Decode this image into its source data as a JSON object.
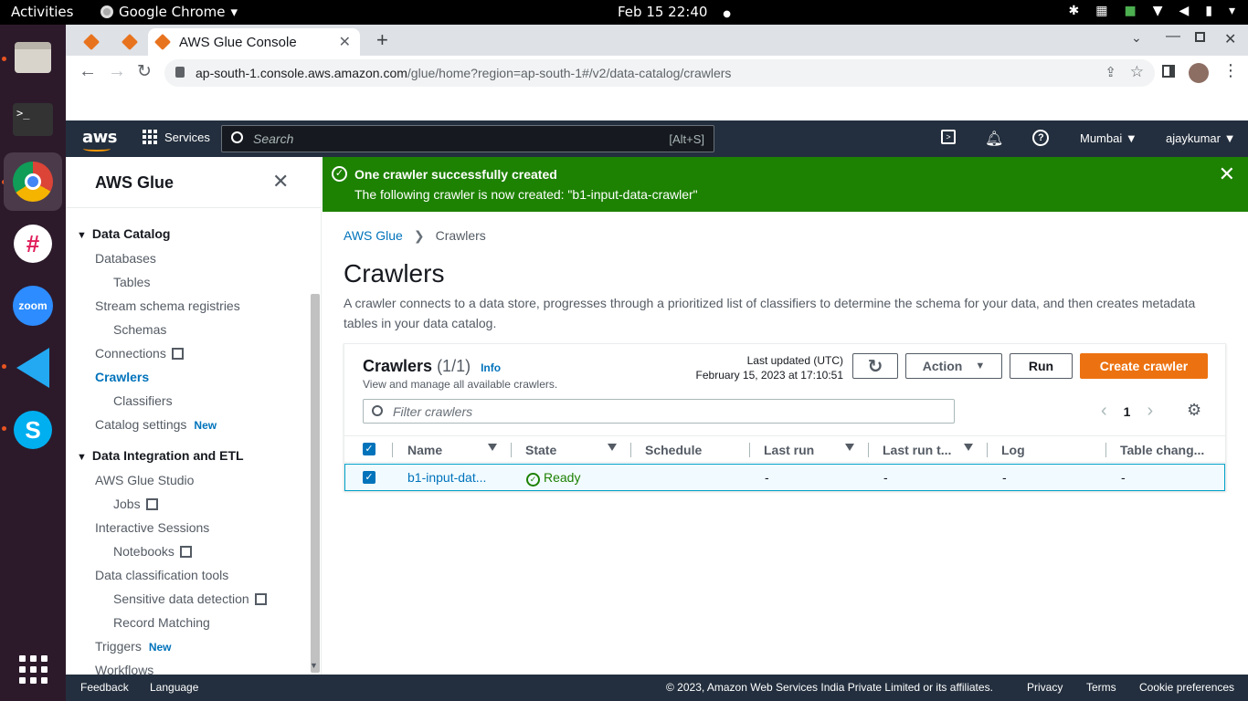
{
  "os": {
    "activities": "Activities",
    "app_name": "Google Chrome",
    "clock": "Feb 15  22:40",
    "dock": [
      "Files",
      "Terminal",
      "Google Chrome",
      "Slack",
      "Zoom",
      "Visual Studio Code",
      "Skype",
      "Show Applications"
    ]
  },
  "browser": {
    "tabs": [
      {
        "label": ""
      },
      {
        "label": ""
      },
      {
        "label": "AWS Glue Console"
      }
    ],
    "url_host": "ap-south-1.console.aws.amazon.com",
    "url_path": "/glue/home?region=ap-south-1#/v2/data-catalog/crawlers"
  },
  "aws_header": {
    "logo": "aws",
    "services_label": "Services",
    "search_placeholder": "Search",
    "search_shortcut": "[Alt+S]",
    "region": "Mumbai",
    "user": "ajaykumar"
  },
  "sidebar": {
    "title": "AWS Glue",
    "data_catalog": "Data Catalog",
    "databases": "Databases",
    "tables": "Tables",
    "stream_schema": "Stream schema registries",
    "schemas": "Schemas",
    "connections": "Connections",
    "crawlers": "Crawlers",
    "classifiers": "Classifiers",
    "catalog_settings": "Catalog settings",
    "new_badge": "New",
    "data_integration": "Data Integration and ETL",
    "glue_studio": "AWS Glue Studio",
    "jobs": "Jobs",
    "interactive": "Interactive Sessions",
    "notebooks": "Notebooks",
    "classification": "Data classification tools",
    "sensitive": "Sensitive data detection",
    "record_matching": "Record Matching",
    "triggers": "Triggers",
    "workflows": "Workflows"
  },
  "flash": {
    "title": "One crawler successfully created",
    "body": "The following crawler is now created: \"b1-input-data-crawler\""
  },
  "main": {
    "breadcrumb_root": "AWS Glue",
    "breadcrumb_current": "Crawlers",
    "title": "Crawlers",
    "description": "A crawler connects to a data store, progresses through a prioritized list of classifiers to determine the schema for your data, and then creates metadata tables in your data catalog."
  },
  "panel": {
    "title": "Crawlers",
    "count": "(1/1)",
    "info": "Info",
    "subtitle": "View and manage all available crawlers.",
    "updated_label": "Last updated (UTC)",
    "updated_value": "February 15, 2023 at 17:10:51",
    "action_label": "Action",
    "run_label": "Run",
    "create_label": "Create crawler",
    "filter_placeholder": "Filter crawlers",
    "page": "1",
    "columns": [
      "Name",
      "State",
      "Schedule",
      "Last run",
      "Last run t...",
      "Log",
      "Table chang..."
    ],
    "rows": [
      {
        "name": "b1-input-dat...",
        "state": "Ready",
        "schedule": "",
        "last_run": "-",
        "last_run_time": "-",
        "log": "-",
        "table_changes": "-"
      }
    ]
  },
  "footer": {
    "feedback": "Feedback",
    "language": "Language",
    "copyright": "© 2023, Amazon Web Services India Private Limited or its affiliates.",
    "privacy": "Privacy",
    "terms": "Terms",
    "cookies": "Cookie preferences"
  },
  "colors": {
    "aws_nav": "#232f3e",
    "success": "#1d8102",
    "primary": "#ec7211",
    "link": "#0073bb"
  }
}
